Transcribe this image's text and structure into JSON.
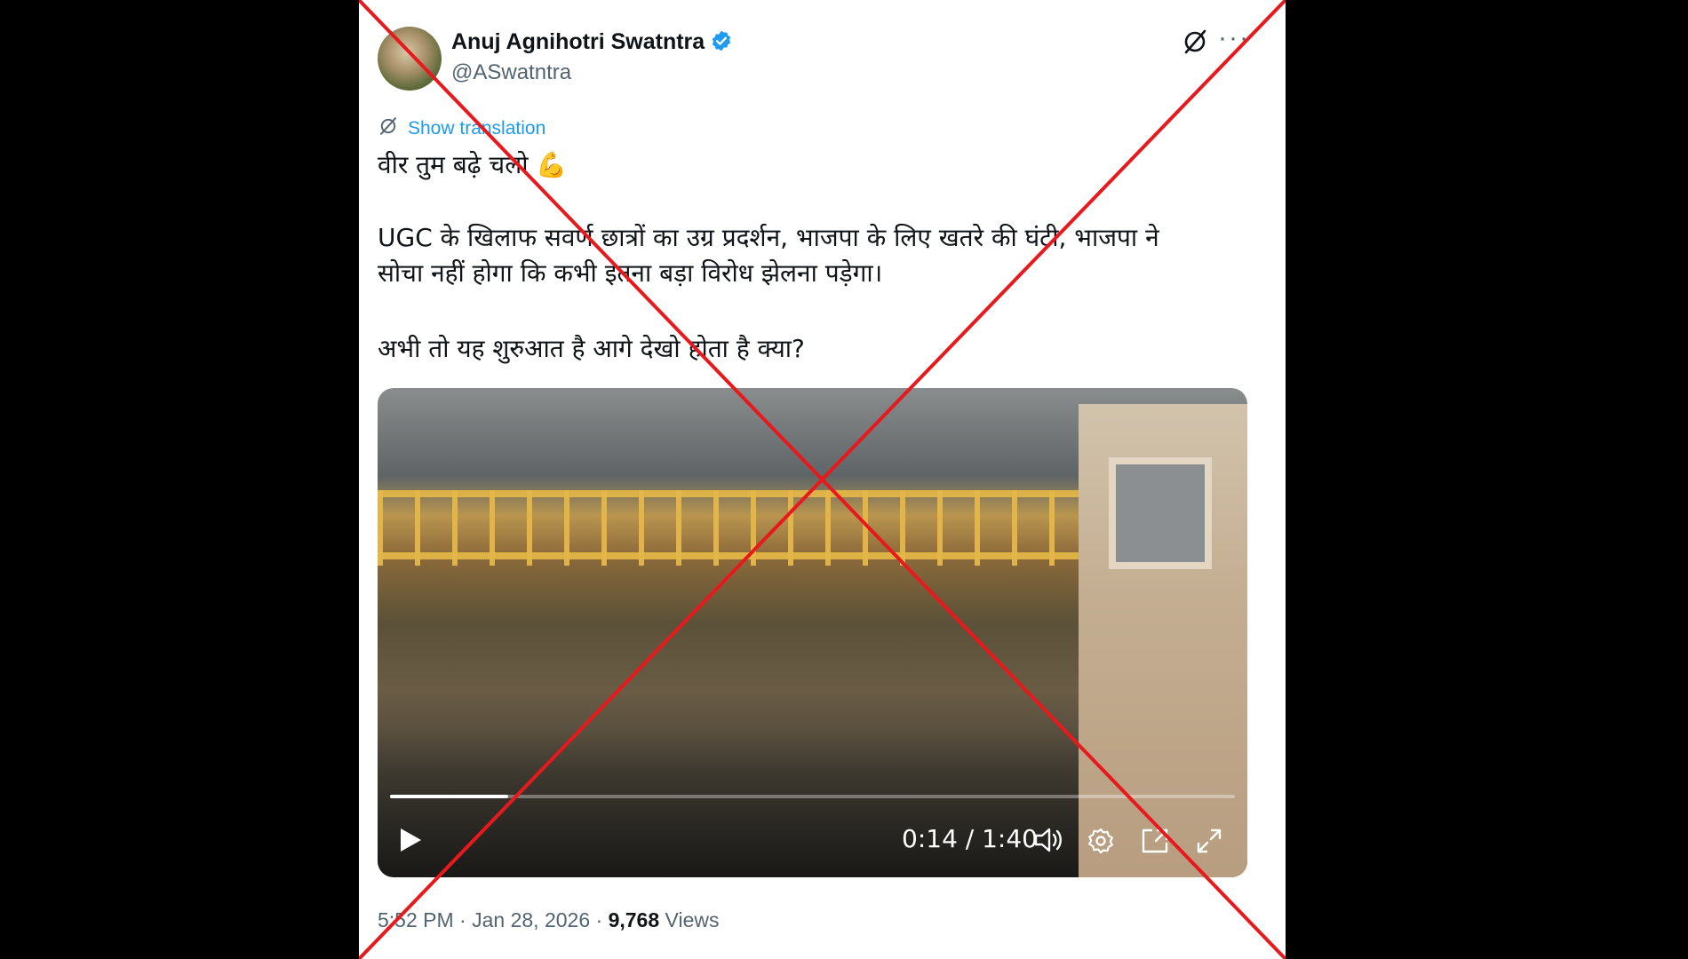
{
  "author": {
    "name": "Anuj Agnihotri Swatntra",
    "handle": "@ASwatntra",
    "verified": true
  },
  "tweet": {
    "translate_label": "Show translation",
    "line1": "वीर तुम बढ़े चलो 💪",
    "line2": "UGC के खिलाफ सवर्ण छात्रों का उग्र प्रदर्शन, भाजपा के लिए खतरे की घंटी, भाजपा ने",
    "line3": "सोचा नहीं होगा कि कभी इतना बड़ा विरोध झेलना पड़ेगा।",
    "line4": "अभी तो यह शुरुआत है आगे देखो होता है क्या?"
  },
  "video": {
    "current_time": "0:14",
    "total_time": "1:40",
    "time_display": "0:14 / 1:40",
    "progress_fraction": 0.14
  },
  "meta": {
    "time": "5:52 PM",
    "separator": " · ",
    "date": "Jan 28, 2026",
    "views_count": "9,768",
    "views_label": "Views"
  },
  "colors": {
    "accent": "#1d9bf0",
    "text": "#0f1419",
    "secondary": "#536471",
    "cross": "#e8191c"
  },
  "icons": [
    "verified-badge-icon",
    "grok-icon",
    "more-icon",
    "translate-icon",
    "play-icon",
    "volume-icon",
    "settings-icon",
    "pip-icon",
    "fullscreen-icon"
  ]
}
